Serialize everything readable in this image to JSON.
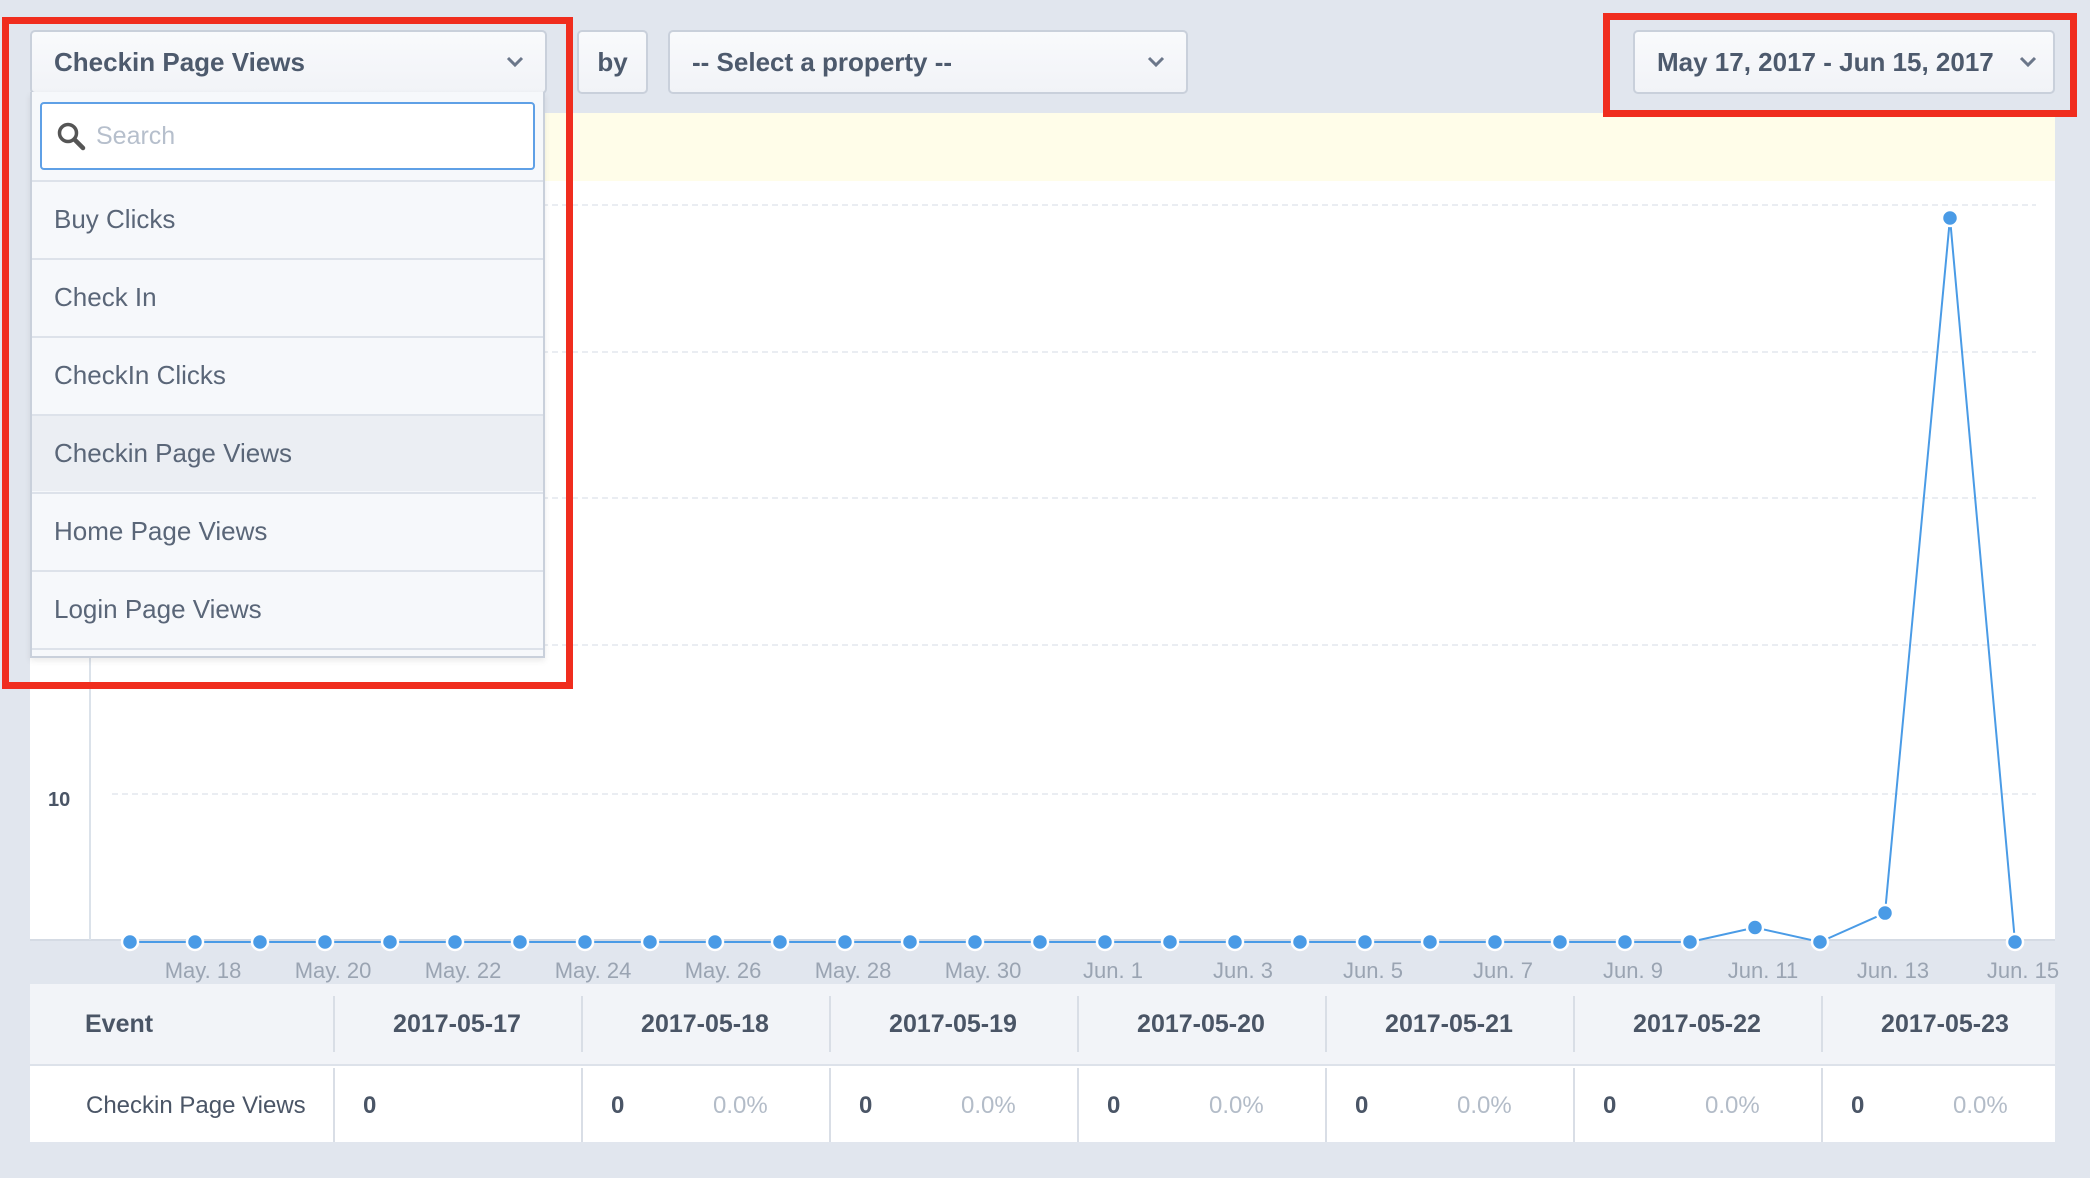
{
  "toolbar": {
    "event_select": "Checkin Page Views",
    "by_label": "by",
    "property_select": "-- Select a property --",
    "date_range": "May 17, 2017 - Jun 15, 2017"
  },
  "dropdown": {
    "search_placeholder": "Search",
    "items": [
      {
        "label": "Buy Clicks",
        "selected": false
      },
      {
        "label": "Check In",
        "selected": false
      },
      {
        "label": "CheckIn Clicks",
        "selected": false
      },
      {
        "label": "Checkin Page Views",
        "selected": true
      },
      {
        "label": "Home Page Views",
        "selected": false
      },
      {
        "label": "Login Page Views",
        "selected": false
      }
    ]
  },
  "colors": {
    "line": "#4a9be6",
    "highlight": "#f02d1e",
    "banner": "#fffde9"
  },
  "chart_data": {
    "type": "line",
    "visible_y_tick": "10",
    "x": [
      "2017-05-17",
      "2017-05-18",
      "2017-05-19",
      "2017-05-20",
      "2017-05-21",
      "2017-05-22",
      "2017-05-23",
      "2017-05-24",
      "2017-05-25",
      "2017-05-26",
      "2017-05-27",
      "2017-05-28",
      "2017-05-29",
      "2017-05-30",
      "2017-05-31",
      "2017-06-01",
      "2017-06-02",
      "2017-06-03",
      "2017-06-04",
      "2017-06-05",
      "2017-06-06",
      "2017-06-07",
      "2017-06-08",
      "2017-06-09",
      "2017-06-10",
      "2017-06-11",
      "2017-06-12",
      "2017-06-13",
      "2017-06-14",
      "2017-06-15"
    ],
    "series": [
      {
        "values": [
          0,
          0,
          0,
          0,
          0,
          0,
          0,
          0,
          0,
          0,
          0,
          0,
          0,
          0,
          0,
          0,
          0,
          0,
          0,
          0,
          0,
          0,
          0,
          0,
          0,
          1,
          0,
          2,
          50,
          0
        ]
      }
    ],
    "x_tick_labels": [
      "May. 18",
      "May. 20",
      "May. 22",
      "May. 24",
      "May. 26",
      "May. 28",
      "May. 30",
      "Jun. 1",
      "Jun. 3",
      "Jun. 5",
      "Jun. 7",
      "Jun. 9",
      "Jun. 11",
      "Jun. 13",
      "Jun. 15"
    ],
    "ylim": [
      0,
      50
    ],
    "grid": true
  },
  "table": {
    "event_header": "Event",
    "dates": [
      "2017-05-17",
      "2017-05-18",
      "2017-05-19",
      "2017-05-20",
      "2017-05-21",
      "2017-05-22",
      "2017-05-23"
    ],
    "row": {
      "event": "Checkin Page Views",
      "values": [
        "0",
        "0",
        "0",
        "0",
        "0",
        "0",
        "0"
      ],
      "pcts": [
        "",
        "0.0%",
        "0.0%",
        "0.0%",
        "0.0%",
        "0.0%",
        "0.0%"
      ]
    }
  }
}
